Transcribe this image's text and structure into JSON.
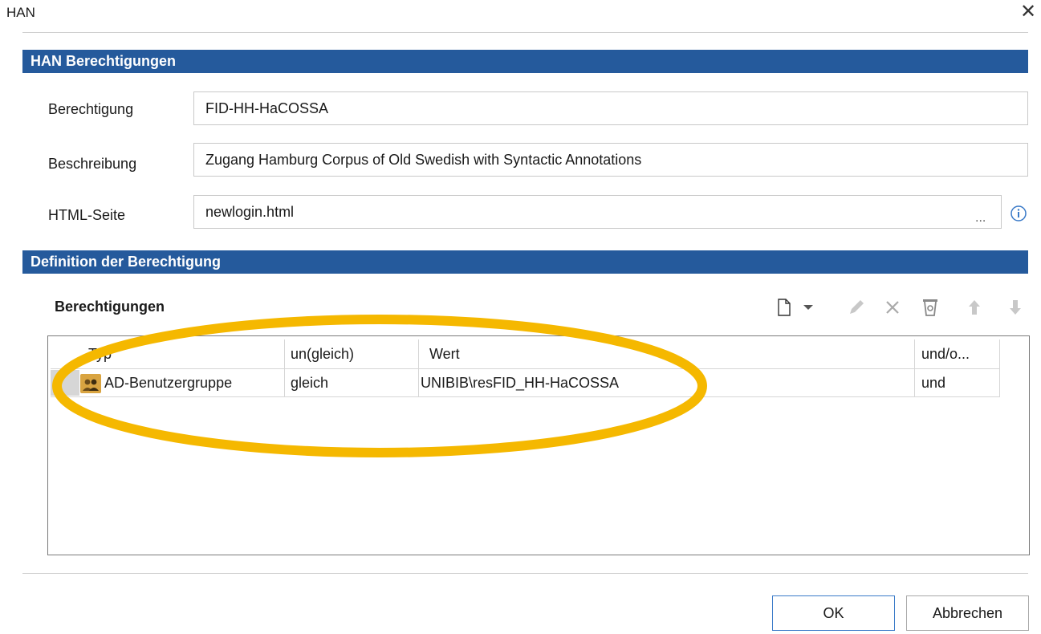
{
  "window": {
    "title": "HAN",
    "close_glyph": "✕"
  },
  "section1": {
    "title": "HAN Berechtigungen",
    "fields": {
      "permission": {
        "label": "Berechtigung",
        "value": "FID-HH-HaCOSSA"
      },
      "description": {
        "label": "Beschreibung",
        "value": "Zugang Hamburg Corpus of Old Swedish with Syntactic Annotations"
      },
      "html_page": {
        "label": "HTML-Seite",
        "value": "newlogin.html",
        "browse_label": "..."
      }
    }
  },
  "section2": {
    "title": "Definition der Berechtigung",
    "list_title": "Berechtigungen",
    "toolbar": [
      "new-document-icon",
      "dropdown-arrow-icon",
      "edit-pencil-icon",
      "delete-x-icon",
      "clear-icon",
      "move-up-icon",
      "move-down-icon"
    ],
    "table": {
      "columns": [
        "Typ",
        "un(gleich)",
        "Wert",
        "und/o..."
      ],
      "rows": [
        {
          "type": "AD-Benutzergruppe",
          "type_icon": "user-group-icon",
          "operator": "gleich",
          "value": "UNIBIB\\resFID_HH-HaCOSSA",
          "logic": "und"
        }
      ]
    }
  },
  "buttons": {
    "ok": "OK",
    "cancel": "Abbrechen"
  },
  "colors": {
    "section_bar": "#255a9c",
    "highlight_ellipse": "#f5b800",
    "ok_border": "#3a7ac8"
  }
}
